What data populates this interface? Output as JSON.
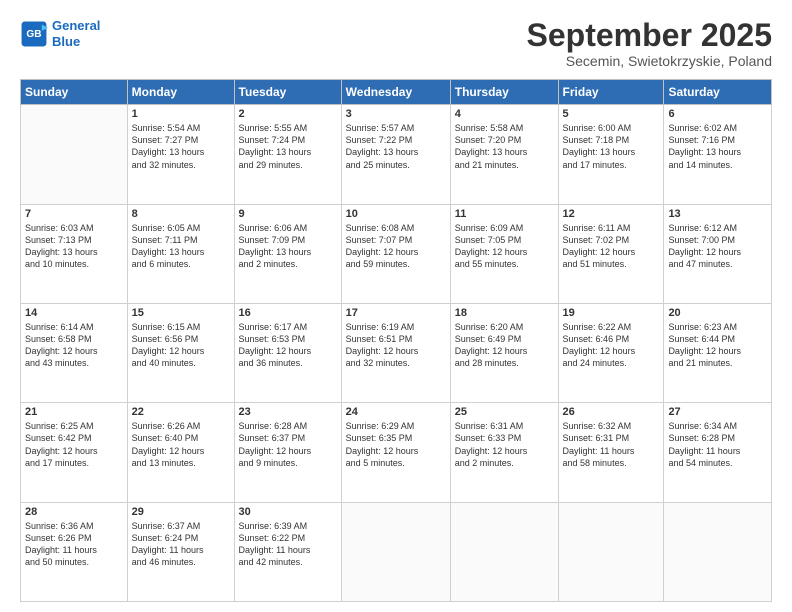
{
  "header": {
    "logo_line1": "General",
    "logo_line2": "Blue",
    "month": "September 2025",
    "location": "Secemin, Swietokrzyskie, Poland"
  },
  "weekdays": [
    "Sunday",
    "Monday",
    "Tuesday",
    "Wednesday",
    "Thursday",
    "Friday",
    "Saturday"
  ],
  "weeks": [
    [
      {
        "day": "",
        "info": ""
      },
      {
        "day": "1",
        "info": "Sunrise: 5:54 AM\nSunset: 7:27 PM\nDaylight: 13 hours\nand 32 minutes."
      },
      {
        "day": "2",
        "info": "Sunrise: 5:55 AM\nSunset: 7:24 PM\nDaylight: 13 hours\nand 29 minutes."
      },
      {
        "day": "3",
        "info": "Sunrise: 5:57 AM\nSunset: 7:22 PM\nDaylight: 13 hours\nand 25 minutes."
      },
      {
        "day": "4",
        "info": "Sunrise: 5:58 AM\nSunset: 7:20 PM\nDaylight: 13 hours\nand 21 minutes."
      },
      {
        "day": "5",
        "info": "Sunrise: 6:00 AM\nSunset: 7:18 PM\nDaylight: 13 hours\nand 17 minutes."
      },
      {
        "day": "6",
        "info": "Sunrise: 6:02 AM\nSunset: 7:16 PM\nDaylight: 13 hours\nand 14 minutes."
      }
    ],
    [
      {
        "day": "7",
        "info": "Sunrise: 6:03 AM\nSunset: 7:13 PM\nDaylight: 13 hours\nand 10 minutes."
      },
      {
        "day": "8",
        "info": "Sunrise: 6:05 AM\nSunset: 7:11 PM\nDaylight: 13 hours\nand 6 minutes."
      },
      {
        "day": "9",
        "info": "Sunrise: 6:06 AM\nSunset: 7:09 PM\nDaylight: 13 hours\nand 2 minutes."
      },
      {
        "day": "10",
        "info": "Sunrise: 6:08 AM\nSunset: 7:07 PM\nDaylight: 12 hours\nand 59 minutes."
      },
      {
        "day": "11",
        "info": "Sunrise: 6:09 AM\nSunset: 7:05 PM\nDaylight: 12 hours\nand 55 minutes."
      },
      {
        "day": "12",
        "info": "Sunrise: 6:11 AM\nSunset: 7:02 PM\nDaylight: 12 hours\nand 51 minutes."
      },
      {
        "day": "13",
        "info": "Sunrise: 6:12 AM\nSunset: 7:00 PM\nDaylight: 12 hours\nand 47 minutes."
      }
    ],
    [
      {
        "day": "14",
        "info": "Sunrise: 6:14 AM\nSunset: 6:58 PM\nDaylight: 12 hours\nand 43 minutes."
      },
      {
        "day": "15",
        "info": "Sunrise: 6:15 AM\nSunset: 6:56 PM\nDaylight: 12 hours\nand 40 minutes."
      },
      {
        "day": "16",
        "info": "Sunrise: 6:17 AM\nSunset: 6:53 PM\nDaylight: 12 hours\nand 36 minutes."
      },
      {
        "day": "17",
        "info": "Sunrise: 6:19 AM\nSunset: 6:51 PM\nDaylight: 12 hours\nand 32 minutes."
      },
      {
        "day": "18",
        "info": "Sunrise: 6:20 AM\nSunset: 6:49 PM\nDaylight: 12 hours\nand 28 minutes."
      },
      {
        "day": "19",
        "info": "Sunrise: 6:22 AM\nSunset: 6:46 PM\nDaylight: 12 hours\nand 24 minutes."
      },
      {
        "day": "20",
        "info": "Sunrise: 6:23 AM\nSunset: 6:44 PM\nDaylight: 12 hours\nand 21 minutes."
      }
    ],
    [
      {
        "day": "21",
        "info": "Sunrise: 6:25 AM\nSunset: 6:42 PM\nDaylight: 12 hours\nand 17 minutes."
      },
      {
        "day": "22",
        "info": "Sunrise: 6:26 AM\nSunset: 6:40 PM\nDaylight: 12 hours\nand 13 minutes."
      },
      {
        "day": "23",
        "info": "Sunrise: 6:28 AM\nSunset: 6:37 PM\nDaylight: 12 hours\nand 9 minutes."
      },
      {
        "day": "24",
        "info": "Sunrise: 6:29 AM\nSunset: 6:35 PM\nDaylight: 12 hours\nand 5 minutes."
      },
      {
        "day": "25",
        "info": "Sunrise: 6:31 AM\nSunset: 6:33 PM\nDaylight: 12 hours\nand 2 minutes."
      },
      {
        "day": "26",
        "info": "Sunrise: 6:32 AM\nSunset: 6:31 PM\nDaylight: 11 hours\nand 58 minutes."
      },
      {
        "day": "27",
        "info": "Sunrise: 6:34 AM\nSunset: 6:28 PM\nDaylight: 11 hours\nand 54 minutes."
      }
    ],
    [
      {
        "day": "28",
        "info": "Sunrise: 6:36 AM\nSunset: 6:26 PM\nDaylight: 11 hours\nand 50 minutes."
      },
      {
        "day": "29",
        "info": "Sunrise: 6:37 AM\nSunset: 6:24 PM\nDaylight: 11 hours\nand 46 minutes."
      },
      {
        "day": "30",
        "info": "Sunrise: 6:39 AM\nSunset: 6:22 PM\nDaylight: 11 hours\nand 42 minutes."
      },
      {
        "day": "",
        "info": ""
      },
      {
        "day": "",
        "info": ""
      },
      {
        "day": "",
        "info": ""
      },
      {
        "day": "",
        "info": ""
      }
    ]
  ]
}
